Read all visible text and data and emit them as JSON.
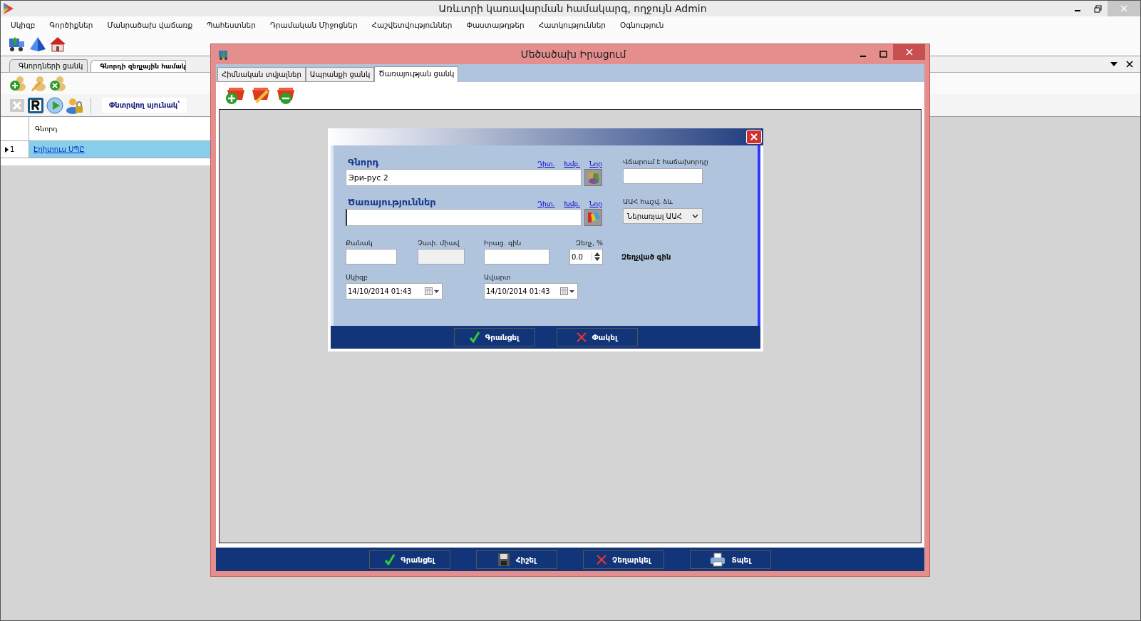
{
  "window": {
    "title": "Առևտրի կառավարման համակարգ, ողջույն Admin"
  },
  "menu": [
    "Սկիզբ",
    "Գործիքներ",
    "Մանրածախ վաճառք",
    "Պահեստներ",
    "Դրամական Միջոցներ",
    "Հաշվետվություններ",
    "Փաստաթղթեր",
    "Հատկություններ",
    "Օգնություն"
  ],
  "doc_tabs": [
    {
      "label": "Գնորդների ցանկ",
      "selected": false
    },
    {
      "label": "Գնորդի զեղչային համակ",
      "selected": true
    }
  ],
  "search_label": "Փնտրվող սյունակ՝",
  "grid": {
    "columns": [
      "Գնորդ"
    ],
    "rows": [
      {
        "number": "1",
        "cells": [
          "Էրիտուս ՍՊԸ"
        ],
        "selected": true
      }
    ]
  },
  "dialog": {
    "title": "Մեծածախ Իրացում",
    "tabs": [
      {
        "label": "Հիմնական տվյալներ",
        "selected": false
      },
      {
        "label": "Ապրանքի ցանկ",
        "selected": false
      },
      {
        "label": "Ծառայության ցանկ",
        "selected": true
      }
    ],
    "form": {
      "customer": {
        "label": "Գնորդ",
        "links": [
          "Դիտ.",
          "Խմբ.",
          "Նոր"
        ],
        "value": "Эри-рус 2"
      },
      "services": {
        "label": "Ծառայություններ",
        "links": [
          "Դիտ.",
          "Խմբ.",
          "Նոր"
        ]
      },
      "payer": {
        "label": "Վճարում է հաճախորդը"
      },
      "vat": {
        "label": "ԱԱՀ հաշվ. ձև",
        "value": "Ներառյալ ԱԱՀ"
      },
      "quantity": {
        "label": "Քանակ"
      },
      "unit": {
        "label": "Չափ. միավ",
        "disabled": true
      },
      "price": {
        "label": "Իրաց. գին"
      },
      "discount": {
        "label": "Զեղչ, %",
        "value": "0.0"
      },
      "discounted_price": {
        "label": "Զեղչված գին"
      },
      "start": {
        "label": "Սկիզբ",
        "value": "14/10/2014 01:43"
      },
      "end": {
        "label": "Ավարտ",
        "value": "14/10/2014 01:43"
      },
      "buttons": [
        {
          "label": "Գրանցել",
          "kind": "save"
        },
        {
          "label": "Փակել",
          "kind": "close"
        }
      ]
    },
    "buttons": [
      {
        "label": "Գրանցել",
        "kind": "save"
      },
      {
        "label": "Հիշել",
        "kind": "remember"
      },
      {
        "label": "Չեղարկել",
        "kind": "cancel"
      },
      {
        "label": "Տպել",
        "kind": "print"
      }
    ]
  }
}
